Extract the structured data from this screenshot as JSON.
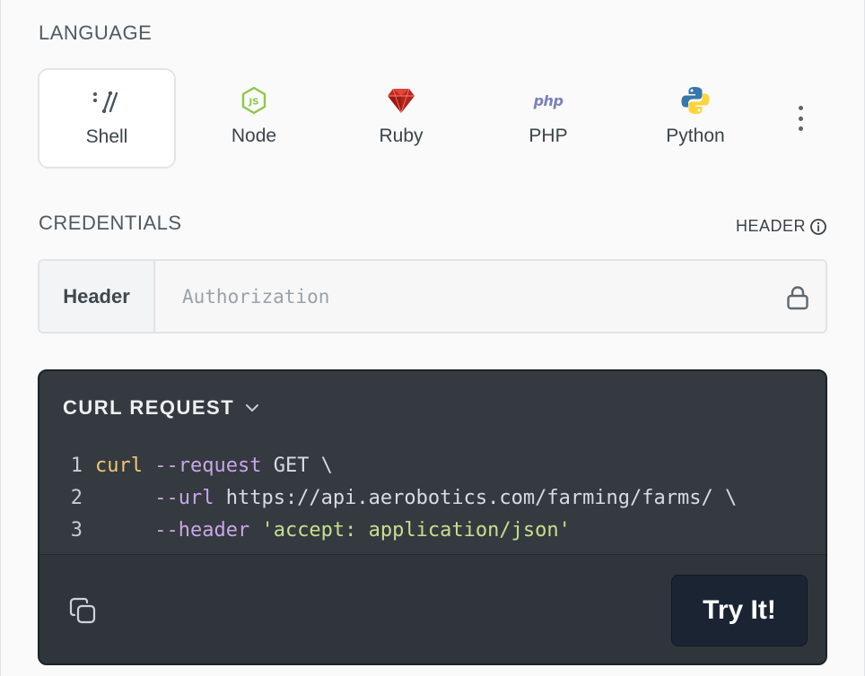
{
  "language": {
    "title": "LANGUAGE",
    "tabs": [
      {
        "label": "Shell",
        "icon": "shell-icon",
        "active": true
      },
      {
        "label": "Node",
        "icon": "nodejs-icon",
        "active": false,
        "color": "#8cc84b"
      },
      {
        "label": "Ruby",
        "icon": "ruby-icon",
        "active": false,
        "color": "#c3261b"
      },
      {
        "label": "PHP",
        "icon": "php-icon",
        "glyph": "php",
        "active": false,
        "color": "#7a7fbe"
      },
      {
        "label": "Python",
        "icon": "python-icon",
        "active": false,
        "colors": [
          "#3776ab",
          "#ffd43b"
        ]
      }
    ],
    "more_icon": "more-vertical-icon"
  },
  "credentials": {
    "title": "CREDENTIALS",
    "header_link": "HEADER",
    "header_link_icon": "info-icon",
    "field_label": "Header",
    "placeholder": "Authorization",
    "value": "",
    "field_icon": "lock-icon"
  },
  "request": {
    "title": "CURL REQUEST",
    "title_icon": "chevron-down-icon",
    "lines": [
      {
        "num": "1",
        "tokens": [
          {
            "t": "curl",
            "c": "cmd"
          },
          {
            "t": " ",
            "c": "plain"
          },
          {
            "t": "--request",
            "c": "flag"
          },
          {
            "t": " GET \\",
            "c": "plain"
          }
        ]
      },
      {
        "num": "2",
        "tokens": [
          {
            "t": "     ",
            "c": "plain"
          },
          {
            "t": "--url",
            "c": "flag"
          },
          {
            "t": " https://api.aerobotics.com/farming/farms/ \\",
            "c": "plain"
          }
        ]
      },
      {
        "num": "3",
        "tokens": [
          {
            "t": "     ",
            "c": "plain"
          },
          {
            "t": "--header",
            "c": "flag"
          },
          {
            "t": " ",
            "c": "plain"
          },
          {
            "t": "'accept: application/json'",
            "c": "str"
          }
        ]
      }
    ],
    "copy_icon": "copy-icon",
    "try_label": "Try It!"
  },
  "colors": {
    "panel_bg": "#343a40",
    "try_button_bg": "#1b2433",
    "accent_flag": "#c9a6e6",
    "accent_string": "#c5e08c",
    "accent_command": "#f0c674"
  }
}
